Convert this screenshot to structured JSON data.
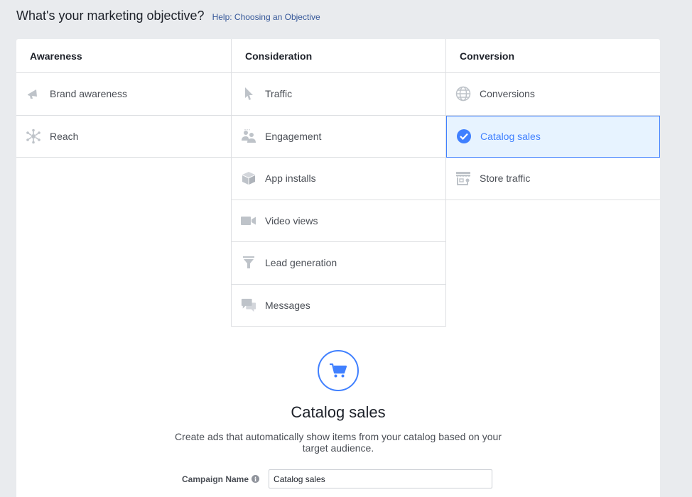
{
  "header": {
    "title": "What's your marketing objective?",
    "help_link": "Help: Choosing an Objective"
  },
  "columns": {
    "awareness": {
      "heading": "Awareness",
      "items": [
        {
          "label": "Brand awareness",
          "icon": "megaphone-icon"
        },
        {
          "label": "Reach",
          "icon": "reach-icon"
        }
      ]
    },
    "consideration": {
      "heading": "Consideration",
      "items": [
        {
          "label": "Traffic",
          "icon": "cursor-icon"
        },
        {
          "label": "Engagement",
          "icon": "people-icon"
        },
        {
          "label": "App installs",
          "icon": "box-icon"
        },
        {
          "label": "Video views",
          "icon": "video-camera-icon"
        },
        {
          "label": "Lead generation",
          "icon": "funnel-icon"
        },
        {
          "label": "Messages",
          "icon": "chat-bubbles-icon"
        }
      ]
    },
    "conversion": {
      "heading": "Conversion",
      "items": [
        {
          "label": "Conversions",
          "icon": "globe-icon"
        },
        {
          "label": "Catalog sales",
          "icon": "checkmark-circle-icon",
          "selected": true
        },
        {
          "label": "Store traffic",
          "icon": "store-icon"
        }
      ]
    }
  },
  "detail": {
    "icon": "shopping-cart-icon",
    "title": "Catalog sales",
    "description": "Create ads that automatically show items from your catalog based on your target audience."
  },
  "campaign": {
    "label": "Campaign Name",
    "info_icon": "i",
    "value": "Catalog sales"
  },
  "colors": {
    "accent": "#4080ff",
    "selected_bg": "#e7f3ff",
    "icon_gray": "#bec3c9",
    "link": "#365899"
  }
}
